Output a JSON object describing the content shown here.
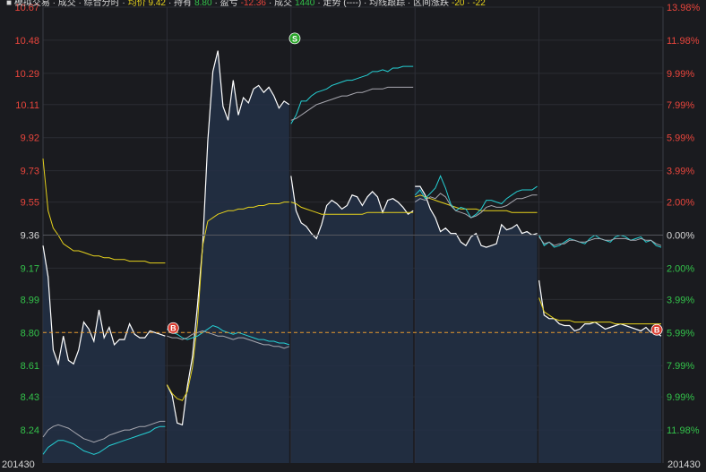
{
  "chart_data": {
    "type": "line",
    "title": "",
    "price_axis": {
      "ticks": [
        "10.67",
        "10.48",
        "10.29",
        "10.11",
        "9.92",
        "9.73",
        "9.55",
        "9.36",
        "9.17",
        "8.99",
        "8.80",
        "8.61",
        "8.43",
        "8.24"
      ],
      "min": 8.05,
      "max": 10.67,
      "ref": 9.36,
      "cost_line": 8.8
    },
    "pct_axis": {
      "ticks": [
        "13.98%",
        "11.98%",
        "9.99%",
        "7.99%",
        "5.99%",
        "3.99%",
        "2.00%",
        "0.00%",
        "2.00%",
        "3.99%",
        "5.99%",
        "7.99%",
        "9.99%",
        "11.98%"
      ]
    },
    "x_axis": {
      "start_label": "201430",
      "end_label": "201430"
    },
    "day_separators": 4,
    "markers": [
      {
        "type": "S",
        "day": 2,
        "pos": 0.03,
        "price": 10.47,
        "color": "#2aa52a"
      },
      {
        "type": "B",
        "day": 1,
        "pos": 0.05,
        "price": 8.79,
        "color": "#d93a2e"
      },
      {
        "type": "B",
        "day": 5,
        "pos": 0.95,
        "price": 8.78,
        "color": "#d93a2e"
      }
    ],
    "series": [
      {
        "key": "price",
        "color": "#ffffff",
        "days": [
          [
            9.3,
            9.12,
            8.7,
            8.62,
            8.78,
            8.64,
            8.62,
            8.7,
            8.86,
            8.82,
            8.75,
            8.93,
            8.77,
            8.83,
            8.73,
            8.76,
            8.76,
            8.85,
            8.79,
            8.77,
            8.77,
            8.81,
            8.8,
            8.79,
            8.78
          ],
          [
            8.5,
            8.44,
            8.28,
            8.27,
            8.49,
            8.66,
            8.96,
            9.3,
            9.9,
            10.3,
            10.42,
            10.1,
            10.02,
            10.25,
            10.05,
            10.15,
            10.12,
            10.2,
            10.22,
            10.18,
            10.21,
            10.16,
            10.09,
            10.13,
            10.11
          ],
          [
            9.7,
            9.5,
            9.43,
            9.41,
            9.37,
            9.34,
            9.42,
            9.53,
            9.56,
            9.54,
            9.51,
            9.53,
            9.59,
            9.58,
            9.53,
            9.58,
            9.61,
            9.58,
            9.49,
            9.56,
            9.57,
            9.55,
            9.52,
            9.48,
            9.5
          ],
          [
            9.64,
            9.64,
            9.59,
            9.51,
            9.46,
            9.38,
            9.4,
            9.37,
            9.37,
            9.32,
            9.3,
            9.35,
            9.37,
            9.3,
            9.29,
            9.3,
            9.31,
            9.42,
            9.39,
            9.4,
            9.42,
            9.37,
            9.38,
            9.36,
            9.37
          ],
          [
            9.1,
            8.9,
            8.88,
            8.88,
            8.85,
            8.84,
            8.84,
            8.81,
            8.82,
            8.85,
            8.85,
            8.86,
            8.84,
            8.82,
            8.83,
            8.84,
            8.85,
            8.84,
            8.83,
            8.82,
            8.81,
            8.83,
            8.8,
            8.8,
            8.78
          ]
        ]
      },
      {
        "key": "avg",
        "color": "#e6d21c",
        "days": [
          [
            9.8,
            9.5,
            9.4,
            9.36,
            9.31,
            9.29,
            9.27,
            9.27,
            9.26,
            9.25,
            9.24,
            9.24,
            9.23,
            9.23,
            9.22,
            9.22,
            9.22,
            9.21,
            9.21,
            9.21,
            9.21,
            9.2,
            9.2,
            9.2,
            9.2
          ],
          [
            8.5,
            8.45,
            8.42,
            8.41,
            8.46,
            8.6,
            8.86,
            9.3,
            9.44,
            9.46,
            9.48,
            9.49,
            9.5,
            9.5,
            9.51,
            9.51,
            9.52,
            9.52,
            9.53,
            9.53,
            9.54,
            9.54,
            9.54,
            9.55,
            9.55
          ],
          [
            9.55,
            9.54,
            9.52,
            9.51,
            9.5,
            9.49,
            9.48,
            9.48,
            9.48,
            9.48,
            9.48,
            9.48,
            9.48,
            9.48,
            9.48,
            9.49,
            9.49,
            9.49,
            9.49,
            9.49,
            9.49,
            9.49,
            9.49,
            9.49,
            9.49
          ],
          [
            9.58,
            9.59,
            9.58,
            9.57,
            9.56,
            9.55,
            9.54,
            9.53,
            9.52,
            9.51,
            9.51,
            9.51,
            9.51,
            9.5,
            9.5,
            9.5,
            9.5,
            9.5,
            9.5,
            9.49,
            9.49,
            9.49,
            9.49,
            9.49,
            9.49
          ],
          [
            9.0,
            8.92,
            8.9,
            8.88,
            8.87,
            8.87,
            8.87,
            8.86,
            8.86,
            8.86,
            8.86,
            8.86,
            8.86,
            8.86,
            8.86,
            8.85,
            8.85,
            8.85,
            8.85,
            8.85,
            8.85,
            8.85,
            8.85,
            8.85,
            8.85
          ]
        ]
      },
      {
        "key": "cyan",
        "color": "#25d0d4",
        "days": [
          [
            8.1,
            8.14,
            8.16,
            8.18,
            8.18,
            8.17,
            8.16,
            8.14,
            8.12,
            8.11,
            8.1,
            8.11,
            8.13,
            8.15,
            8.16,
            8.17,
            8.18,
            8.19,
            8.2,
            8.21,
            8.22,
            8.23,
            8.25,
            8.26,
            8.26
          ],
          [
            8.82,
            8.8,
            8.79,
            8.77,
            8.76,
            8.77,
            8.78,
            8.8,
            8.82,
            8.84,
            8.83,
            8.81,
            8.8,
            8.79,
            8.8,
            8.79,
            8.78,
            8.77,
            8.76,
            8.76,
            8.75,
            8.75,
            8.74,
            8.74,
            8.73
          ],
          [
            10.0,
            10.05,
            10.13,
            10.13,
            10.16,
            10.18,
            10.19,
            10.2,
            10.22,
            10.23,
            10.24,
            10.25,
            10.25,
            10.26,
            10.27,
            10.28,
            10.3,
            10.3,
            10.31,
            10.3,
            10.32,
            10.32,
            10.33,
            10.33,
            10.33
          ],
          [
            9.59,
            9.62,
            9.57,
            9.6,
            9.63,
            9.7,
            9.63,
            9.54,
            9.5,
            9.52,
            9.51,
            9.46,
            9.48,
            9.51,
            9.56,
            9.56,
            9.55,
            9.54,
            9.57,
            9.59,
            9.61,
            9.62,
            9.62,
            9.62,
            9.64
          ],
          [
            9.36,
            9.3,
            9.32,
            9.29,
            9.3,
            9.32,
            9.34,
            9.33,
            9.32,
            9.31,
            9.34,
            9.36,
            9.34,
            9.33,
            9.32,
            9.35,
            9.36,
            9.35,
            9.33,
            9.34,
            9.35,
            9.32,
            9.33,
            9.3,
            9.29
          ]
        ]
      },
      {
        "key": "grey",
        "color": "#a8a8b0",
        "days": [
          [
            8.2,
            8.24,
            8.26,
            8.27,
            8.26,
            8.25,
            8.23,
            8.21,
            8.19,
            8.18,
            8.17,
            8.18,
            8.19,
            8.21,
            8.22,
            8.23,
            8.24,
            8.24,
            8.25,
            8.26,
            8.26,
            8.27,
            8.28,
            8.29,
            8.29
          ],
          [
            8.78,
            8.77,
            8.77,
            8.76,
            8.77,
            8.79,
            8.8,
            8.81,
            8.8,
            8.79,
            8.78,
            8.78,
            8.77,
            8.76,
            8.77,
            8.77,
            8.76,
            8.75,
            8.74,
            8.73,
            8.73,
            8.72,
            8.72,
            8.71,
            8.72
          ],
          [
            10.02,
            10.03,
            10.05,
            10.07,
            10.09,
            10.11,
            10.12,
            10.13,
            10.14,
            10.15,
            10.16,
            10.16,
            10.17,
            10.18,
            10.18,
            10.19,
            10.2,
            10.2,
            10.2,
            10.21,
            10.21,
            10.21,
            10.21,
            10.21,
            10.21
          ],
          [
            9.55,
            9.57,
            9.56,
            9.58,
            9.57,
            9.6,
            9.58,
            9.53,
            9.5,
            9.49,
            9.48,
            9.46,
            9.47,
            9.49,
            9.52,
            9.53,
            9.52,
            9.52,
            9.53,
            9.55,
            9.57,
            9.57,
            9.58,
            9.59,
            9.59
          ],
          [
            9.35,
            9.31,
            9.32,
            9.3,
            9.31,
            9.31,
            9.33,
            9.33,
            9.32,
            9.32,
            9.33,
            9.34,
            9.34,
            9.33,
            9.33,
            9.34,
            9.34,
            9.34,
            9.33,
            9.33,
            9.34,
            9.33,
            9.33,
            9.31,
            9.3
          ]
        ]
      }
    ],
    "area_fill": "#233046",
    "header": {
      "segments": [
        {
          "text": "■ 模拟交易 · 成交 · 综合分时 ·",
          "color": "#d8d8d8"
        },
        {
          "text": "均价 9.42",
          "color": "#e6d21c"
        },
        {
          "text": "· 持有",
          "color": "#d8d8d8"
        },
        {
          "text": "8.80",
          "color": "#33c24a"
        },
        {
          "text": "· 盈亏",
          "color": "#d8d8d8"
        },
        {
          "text": "-12.36",
          "color": "#e8453c"
        },
        {
          "text": "· 成交",
          "color": "#d8d8d8"
        },
        {
          "text": "1440",
          "color": "#33c24a"
        },
        {
          "text": "· 走势 (----) · 均线跟踪 · 区间涨跌",
          "color": "#d8d8d8"
        },
        {
          "text": "-20 · -22",
          "color": "#e6d21c"
        }
      ]
    }
  }
}
